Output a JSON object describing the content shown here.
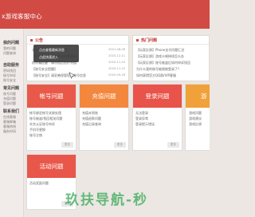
{
  "header": {
    "title": "x游戏客服中心"
  },
  "sidebar": {
    "groups": [
      {
        "title": "我的问题",
        "lines": [
          "我的问题",
          "问题查询"
        ]
      },
      {
        "title": "自助服务",
        "lines": [
          "密码找回",
          "账号申诉",
          "账号安全"
        ]
      },
      {
        "title": "常见问题",
        "lines": [
          "账号问题",
          "充值问题",
          "登录问题"
        ]
      },
      {
        "title": "联系我们",
        "lines": [
          "在线客服",
          "客服邮箱",
          "客服热线",
          "服务时间"
        ]
      }
    ]
  },
  "notice": {
    "title": "公告",
    "items": [
      {
        "text": "关于xx版本更新维护公告",
        "date": "2021-06-08"
      },
      {
        "text": "【客服中心】服务时间调整通知",
        "date": "2020-12-11"
      },
      {
        "text": "防诈骗提醒：请勿相信低价充值",
        "date": "2020-11-24"
      },
      {
        "text": "【账号安全提醒】",
        "date": "2020-11-10"
      },
      {
        "text": "【账号安全】请妥善保管您的账号信息",
        "date": "2020-09-28"
      }
    ]
  },
  "tooltip": {
    "lines": [
      "点击查看最新消息",
      "点此快速进入"
    ]
  },
  "hot": {
    "title": "热门问题",
    "items": [
      "【玩家反馈】Phone支付问题汇总",
      "【玩家反馈】游戏卡顿掉线怎么办",
      "【玩家反馈】账号被盗后如何申诉找回",
      "为什么我的账号被限制登录了？",
      "如何获得官方QQ群/VIP客服"
    ]
  },
  "categories": [
    {
      "title": "帐号问题",
      "color": "#e8594a",
      "lines": [
        "帐号绑定帐号关联处理",
        "账号被盗/找回相关问题",
        "实名认证账号申诉",
        "手机号更换",
        "账号注销"
      ],
      "more": "更多"
    },
    {
      "title": "充值问题",
      "color": "#f2873d",
      "lines": [
        "充值未到账",
        "充值退款问题",
        "充值记录查询"
      ],
      "more": "更多"
    },
    {
      "title": "登录问题",
      "color": "#e8534a",
      "lines": [
        "无法登录",
        "登录异常",
        "登录提示错误"
      ],
      "more": "更多"
    },
    {
      "title": "游",
      "color": "#f0a13a",
      "lines": [
        "游戏问题",
        "游戏建议",
        "游戏反馈"
      ],
      "more": ""
    },
    {
      "title": "活动问题",
      "color": "#e8574a",
      "lines": [
        "活动奖励问题"
      ],
      "more": "更多"
    }
  ],
  "watermark": "玖扶导航-秒"
}
